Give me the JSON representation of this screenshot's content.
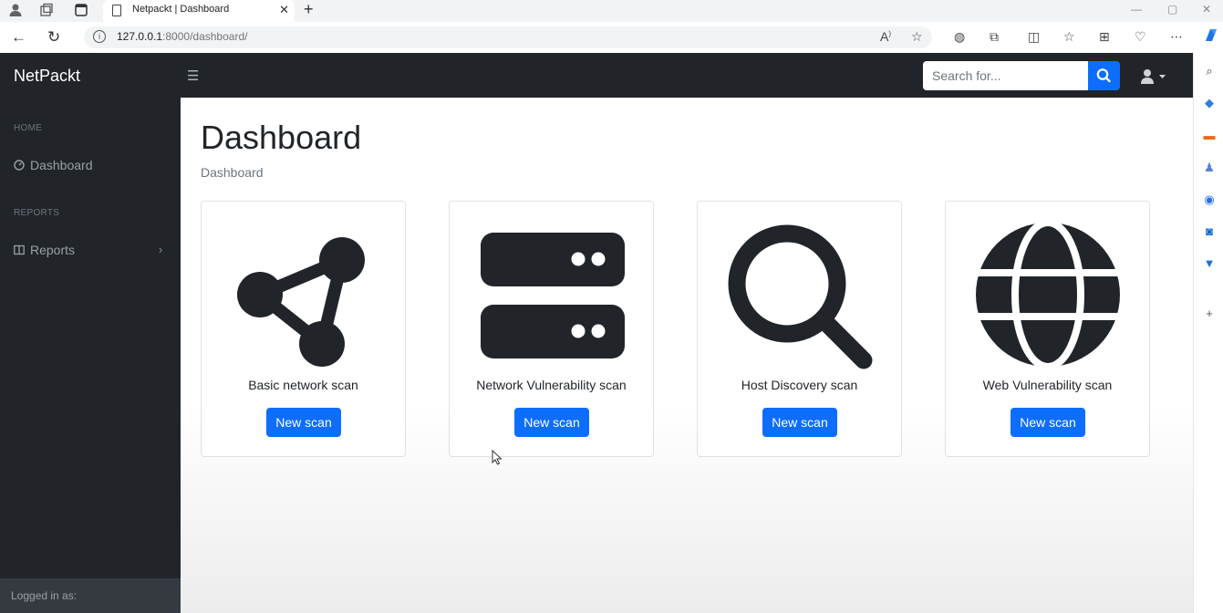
{
  "browser": {
    "tab_title": "Netpackt | Dashboard",
    "url_host": "127.0.0.1",
    "url_path": ":8000/dashboard/"
  },
  "navbar": {
    "brand": "NetPackt",
    "search_placeholder": "Search for..."
  },
  "sidebar": {
    "sections": [
      {
        "heading": "HOME",
        "item": "Dashboard"
      },
      {
        "heading": "REPORTS",
        "item": "Reports"
      }
    ],
    "footer_label": "Logged in as:"
  },
  "main": {
    "title": "Dashboard",
    "breadcrumb": "Dashboard",
    "cards": [
      {
        "label": "Basic network scan",
        "button": "New scan",
        "icon": "network-icon"
      },
      {
        "label": "Network Vulnerability scan",
        "button": "New scan",
        "icon": "server-icon"
      },
      {
        "label": "Host Discovery scan",
        "button": "New scan",
        "icon": "magnifier-icon"
      },
      {
        "label": "Web Vulnerability scan",
        "button": "New scan",
        "icon": "globe-icon"
      }
    ]
  },
  "colors": {
    "dark": "#212529",
    "primary": "#0d6efd"
  }
}
